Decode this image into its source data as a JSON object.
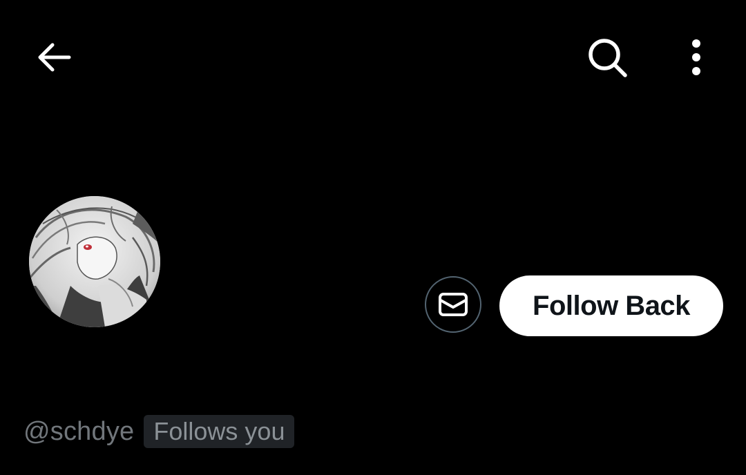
{
  "header": {
    "back_icon": "arrow-left-icon",
    "search_icon": "search-icon",
    "more_icon": "more-vertical-icon"
  },
  "profile": {
    "handle": "@schdye",
    "follows_you_label": "Follows you",
    "follow_back_label": "Follow Back",
    "message_icon": "envelope-icon"
  },
  "colors": {
    "background": "#000000",
    "primary_text": "#e7e9ea",
    "secondary_text": "#71767b",
    "button_bg": "#ffffff",
    "button_text": "#0f1419",
    "border": "#536471",
    "badge_bg": "#202327"
  }
}
